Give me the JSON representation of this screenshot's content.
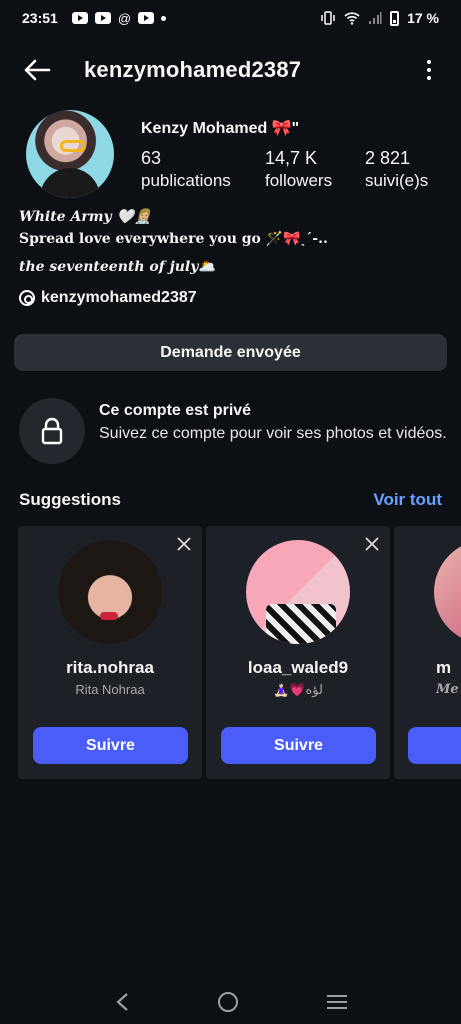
{
  "status_bar": {
    "time": "23:51",
    "battery": "17 %"
  },
  "header": {
    "username": "kenzymohamed2387"
  },
  "profile": {
    "display_name": "Kenzy Mohamed 🎀\"",
    "stats": [
      {
        "value": "63",
        "label": "publications"
      },
      {
        "value": "14,7 K",
        "label": "followers"
      },
      {
        "value": "2 821",
        "label": "suivi(e)s"
      }
    ],
    "bio": {
      "line1": "White Army 🤍👩🏼‍⚕️",
      "line2": "Spread love everywhere you go 🪄🎀ˎˊ-..",
      "line3": "the seventeenth of july🌥️"
    },
    "threads_handle": "kenzymohamed2387",
    "request_button": "Demande envoyée"
  },
  "private_notice": {
    "title": "Ce compte est privé",
    "description": "Suivez ce compte pour voir ses photos et vidéos."
  },
  "suggestions": {
    "title": "Suggestions",
    "see_all": "Voir tout",
    "cards": [
      {
        "username": "rita.nohraa",
        "subtitle": "Rita Nohraa",
        "button": "Suivre"
      },
      {
        "username": "loaa_waled9",
        "subtitle": "🧘🏻‍♀️💗لؤه",
        "button": "Suivre"
      },
      {
        "username": "m",
        "subtitle": "Me",
        "button": ""
      }
    ]
  },
  "colors": {
    "background": "#0c0f14",
    "accent_blue": "#4a5df9",
    "link_blue": "#6aa0ff"
  }
}
